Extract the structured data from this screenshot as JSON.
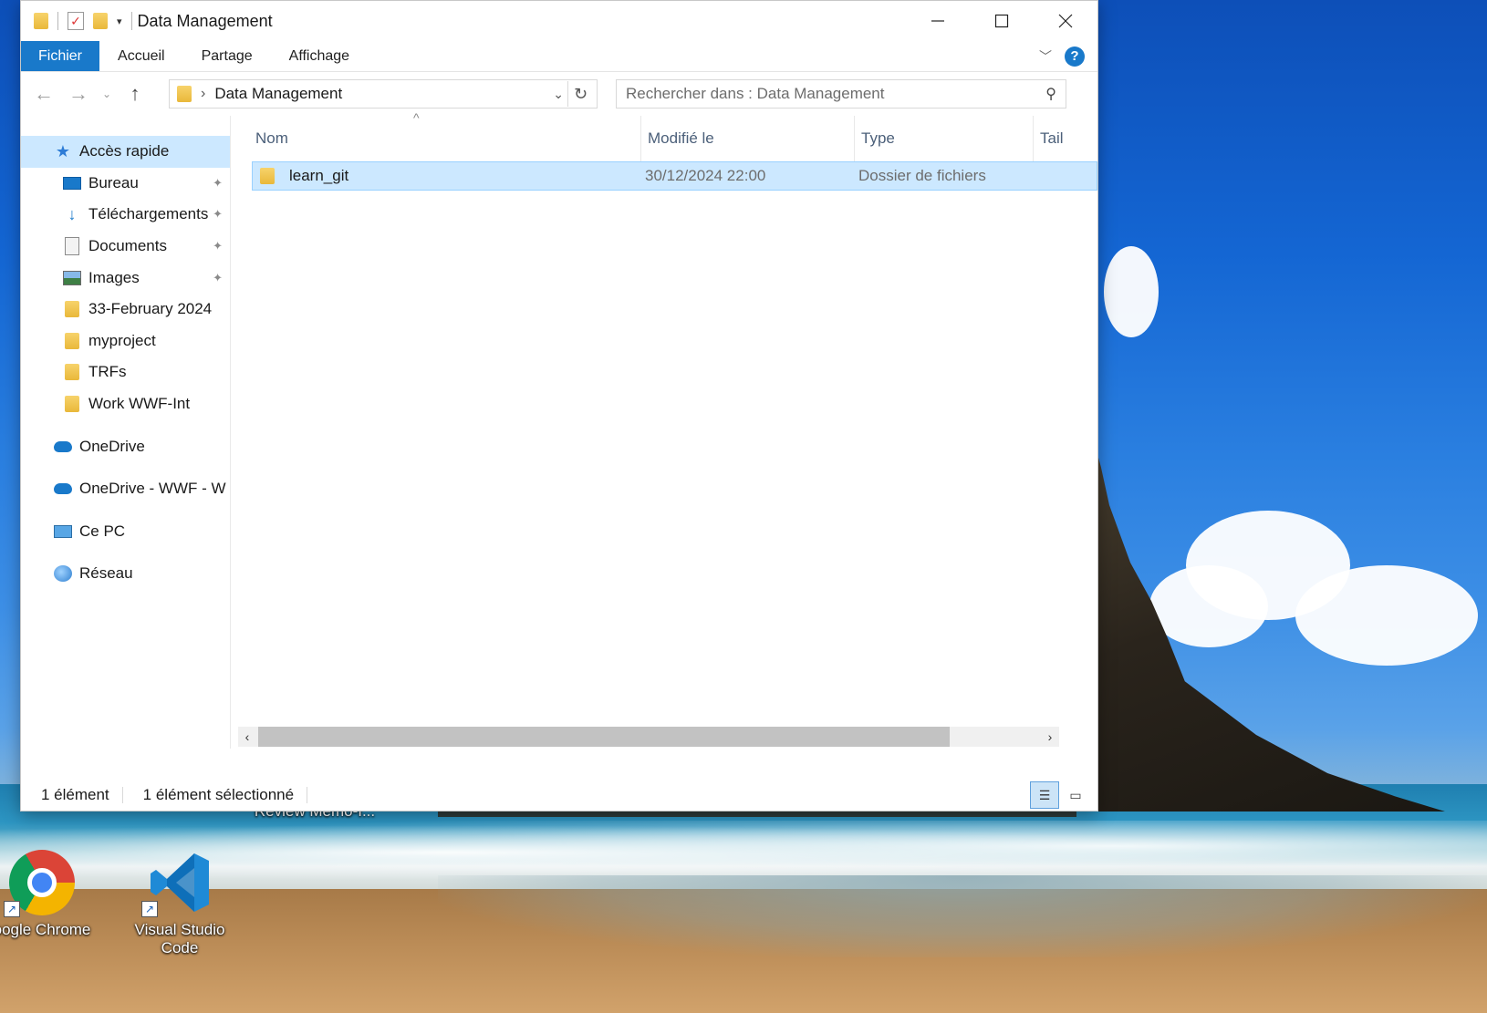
{
  "window": {
    "title": "Data Management",
    "ribbon_tabs": [
      "Fichier",
      "Accueil",
      "Partage",
      "Affichage"
    ],
    "help_label": "?"
  },
  "navigation": {
    "address_path": "Data Management",
    "search_placeholder": "Rechercher dans : Data Management"
  },
  "sidebar": {
    "quick_access_label": "Accès rapide",
    "quick_items": [
      {
        "label": "Bureau",
        "icon": "desktop-icon",
        "pinned": true
      },
      {
        "label": "Téléchargements",
        "icon": "download-icon",
        "pinned": true
      },
      {
        "label": "Documents",
        "icon": "documents-icon",
        "pinned": true
      },
      {
        "label": "Images",
        "icon": "images-icon",
        "pinned": true
      },
      {
        "label": "33-February 2024",
        "icon": "folder-icon",
        "pinned": false
      },
      {
        "label": "myproject",
        "icon": "folder-icon",
        "pinned": false
      },
      {
        "label": "TRFs",
        "icon": "folder-icon",
        "pinned": false
      },
      {
        "label": "Work WWF-Int",
        "icon": "folder-icon",
        "pinned": false
      }
    ],
    "roots": [
      {
        "label": "OneDrive",
        "icon": "onedrive-icon"
      },
      {
        "label": "OneDrive - WWF - W",
        "icon": "onedrive-icon"
      },
      {
        "label": "Ce PC",
        "icon": "pc-icon"
      },
      {
        "label": "Réseau",
        "icon": "network-icon"
      }
    ]
  },
  "file_list": {
    "columns": [
      "Nom",
      "Modifié le",
      "Type",
      "Tail"
    ],
    "rows": [
      {
        "name": "learn_git",
        "modified": "30/12/2024 22:00",
        "type": "Dossier de fichiers",
        "selected": true
      }
    ]
  },
  "status": {
    "count": "1 élément",
    "selected": "1 élément sélectionné"
  },
  "desktop": {
    "icons": [
      {
        "label": "oogle Chrome",
        "icon": "chrome-icon"
      },
      {
        "label": "Visual Studio Code",
        "icon": "vscode-icon"
      }
    ],
    "partial_label": "Review Memo-I..."
  },
  "colors": {
    "accent": "#1979ca",
    "selection": "#cce8ff",
    "selection_border": "#99d1ff"
  }
}
